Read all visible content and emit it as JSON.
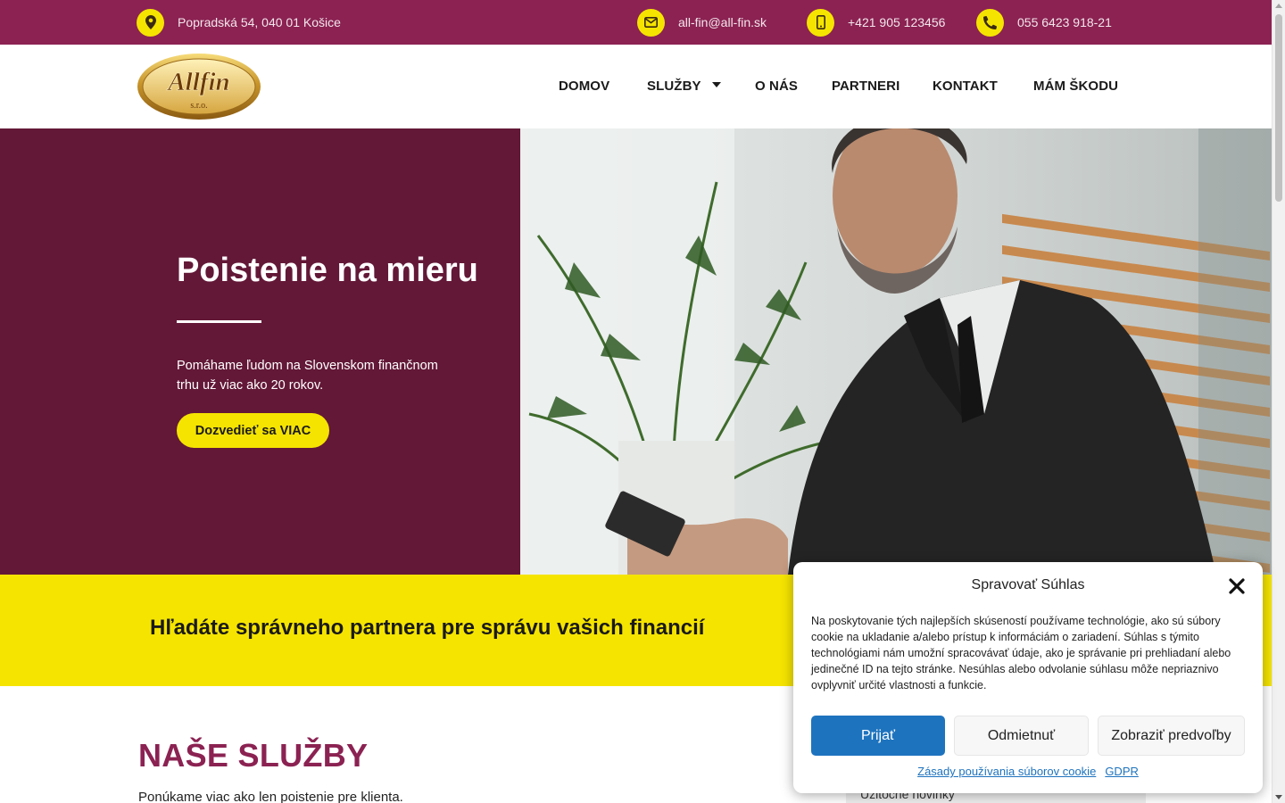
{
  "topbar": {
    "address": "Popradská 54, 040 01 Košice",
    "email": "all-fin@all-fin.sk",
    "mobile": "+421 905 123456",
    "phone": "055 6423 918-21",
    "background": "#8b2252",
    "icon_color": "#f5e400"
  },
  "logo": {
    "text": "Allfin",
    "subtext": "s.r.o."
  },
  "nav": {
    "items": [
      "DOMOV",
      "SLUŽBY",
      "O NÁS",
      "PARTNERI",
      "KONTAKT",
      "MÁM ŠKODU"
    ]
  },
  "hero": {
    "title": "Poistenie na mieru",
    "text": "Pomáhame ľudom na Slovenskom finančnom trhu už viac ako 20 rokov.",
    "button": "Dozvedieť sa VIAC",
    "background": "#631837"
  },
  "band": {
    "title": "Hľadáte správneho partnera pre správu vašich financií",
    "background": "#f5e400"
  },
  "services": {
    "title": "NAŠE SLUŽBY",
    "text": "Ponúkame viac ako len poistenie pre klienta."
  },
  "sidebar": {
    "text": "Užitočné novinky"
  },
  "cookie": {
    "title": "Spravovať Súhlas",
    "body": "Na poskytovanie tých najlepších skúseností používame technológie, ako sú súbory cookie na ukladanie a/alebo prístup k informáciám o zariadení. Súhlas s týmito technológiami nám umožní spracovávať údaje, ako je správanie pri prehliadaní alebo jedinečné ID na tejto stránke. Nesúhlas alebo odvolanie súhlasu môže nepriaznivo ovplyvniť určité vlastnosti a funkcie.",
    "accept": "Prijať",
    "deny": "Odmietnuť",
    "prefs": "Zobraziť predvoľby",
    "link_policy": "Zásady používania súborov cookie",
    "link_gdpr": "GDPR",
    "accent": "#1e73be"
  }
}
